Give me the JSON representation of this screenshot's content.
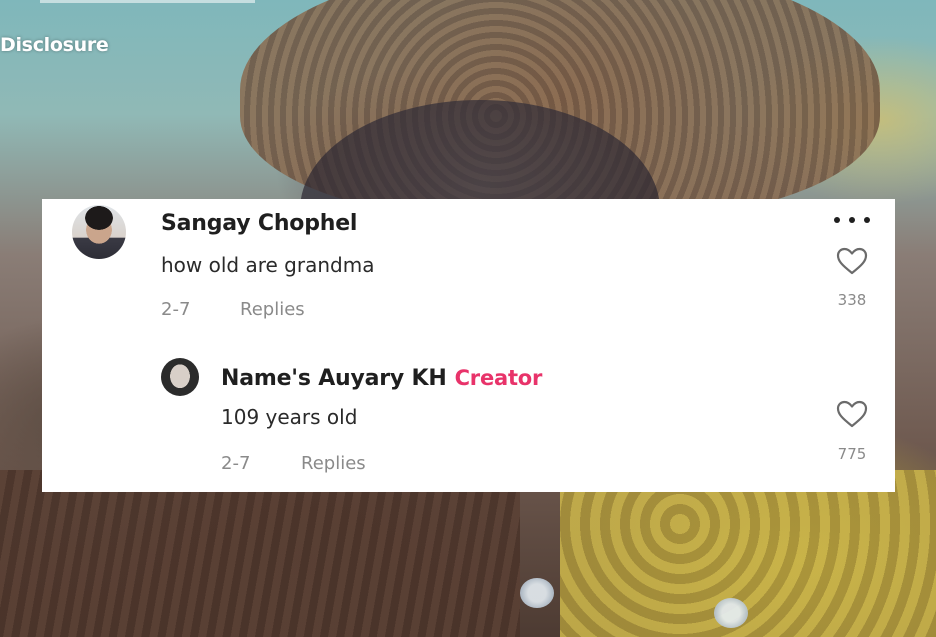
{
  "overlay": {
    "disclosure_label": "Disclosure"
  },
  "comment": {
    "author": "Sangay Chophel",
    "text": "how old are grandma",
    "date": "2-7",
    "replies_label": "Replies",
    "likes": "338",
    "more_icon": "more-horizontal-icon",
    "like_icon": "heart-outline-icon"
  },
  "reply": {
    "author": "Name's Auyary KH",
    "badge": "Creator",
    "badge_color": "#e8336a",
    "text": "109 years old",
    "date": "2-7",
    "replies_label": "Replies",
    "likes": "775",
    "like_icon": "heart-outline-icon"
  }
}
